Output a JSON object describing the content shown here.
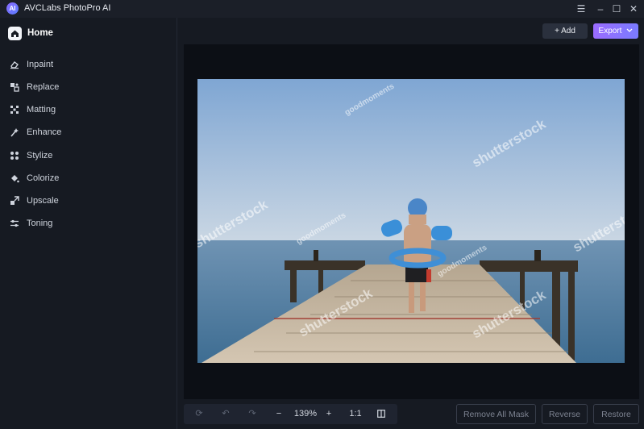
{
  "app": {
    "logo_text": "AI",
    "title": "AVCLabs PhotoPro AI",
    "window_controls": [
      "menu-icon",
      "minimize-icon",
      "maximize-icon",
      "close-icon"
    ]
  },
  "sidebar": {
    "home": {
      "label": "Home",
      "icon": "home-icon"
    },
    "items": [
      {
        "label": "Inpaint",
        "icon": "eraser-icon"
      },
      {
        "label": "Replace",
        "icon": "replace-icon"
      },
      {
        "label": "Matting",
        "icon": "matting-icon"
      },
      {
        "label": "Enhance",
        "icon": "enhance-icon"
      },
      {
        "label": "Stylize",
        "icon": "stylize-icon"
      },
      {
        "label": "Colorize",
        "icon": "colorize-icon"
      },
      {
        "label": "Upscale",
        "icon": "upscale-icon"
      },
      {
        "label": "Toning",
        "icon": "toning-icon"
      }
    ]
  },
  "header": {
    "add_label": "+ Add",
    "export_label": "Export",
    "export_accent": "#8b73ff"
  },
  "canvas": {
    "watermark_brand": "shutterstock",
    "watermark_author": "goodmoments"
  },
  "zoom_bar": {
    "zoom_level": "139%",
    "one_to_one": "1:1"
  },
  "actions": {
    "remove_all_mask": "Remove All Mask",
    "reverse": "Reverse",
    "restore": "Restore"
  }
}
